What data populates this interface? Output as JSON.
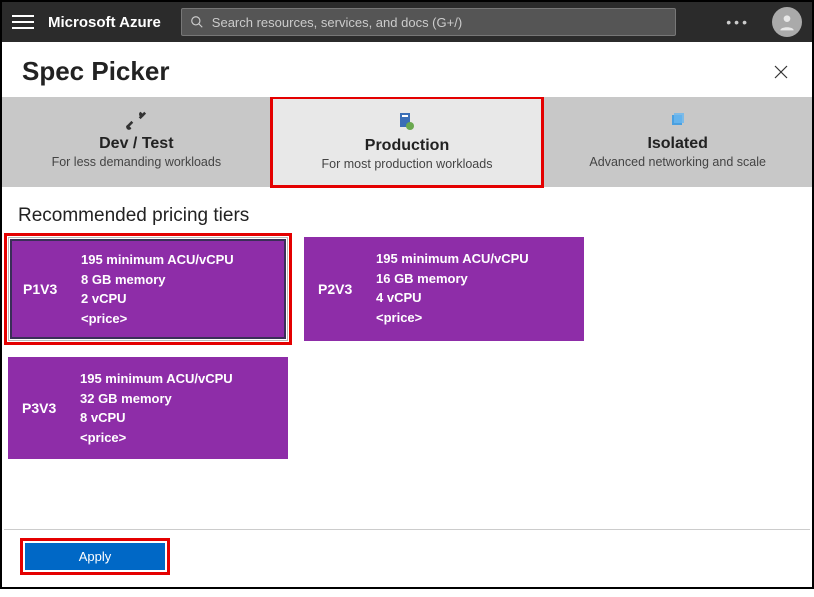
{
  "topbar": {
    "brand": "Microsoft Azure",
    "search_placeholder": "Search resources, services, and docs (G+/)"
  },
  "blade": {
    "title": "Spec Picker"
  },
  "categories": [
    {
      "title": "Dev / Test",
      "subtitle": "For less demanding workloads",
      "selected": false
    },
    {
      "title": "Production",
      "subtitle": "For most production workloads",
      "selected": true
    },
    {
      "title": "Isolated",
      "subtitle": "Advanced networking and scale",
      "selected": false
    }
  ],
  "section_title": "Recommended pricing tiers",
  "tiers": [
    {
      "name": "P1V3",
      "acu": "195 minimum ACU/vCPU",
      "memory": "8 GB memory",
      "vcpu": "2 vCPU",
      "price": "<price>",
      "selected": true
    },
    {
      "name": "P2V3",
      "acu": "195 minimum ACU/vCPU",
      "memory": "16 GB memory",
      "vcpu": "4 vCPU",
      "price": "<price>",
      "selected": false
    },
    {
      "name": "P3V3",
      "acu": "195 minimum ACU/vCPU",
      "memory": "32 GB memory",
      "vcpu": "8 vCPU",
      "price": "<price>",
      "selected": false
    }
  ],
  "footer": {
    "apply_label": "Apply"
  },
  "colors": {
    "tier_bg": "#8e2da8",
    "highlight": "#e40000",
    "primary_button": "#0068c6"
  }
}
